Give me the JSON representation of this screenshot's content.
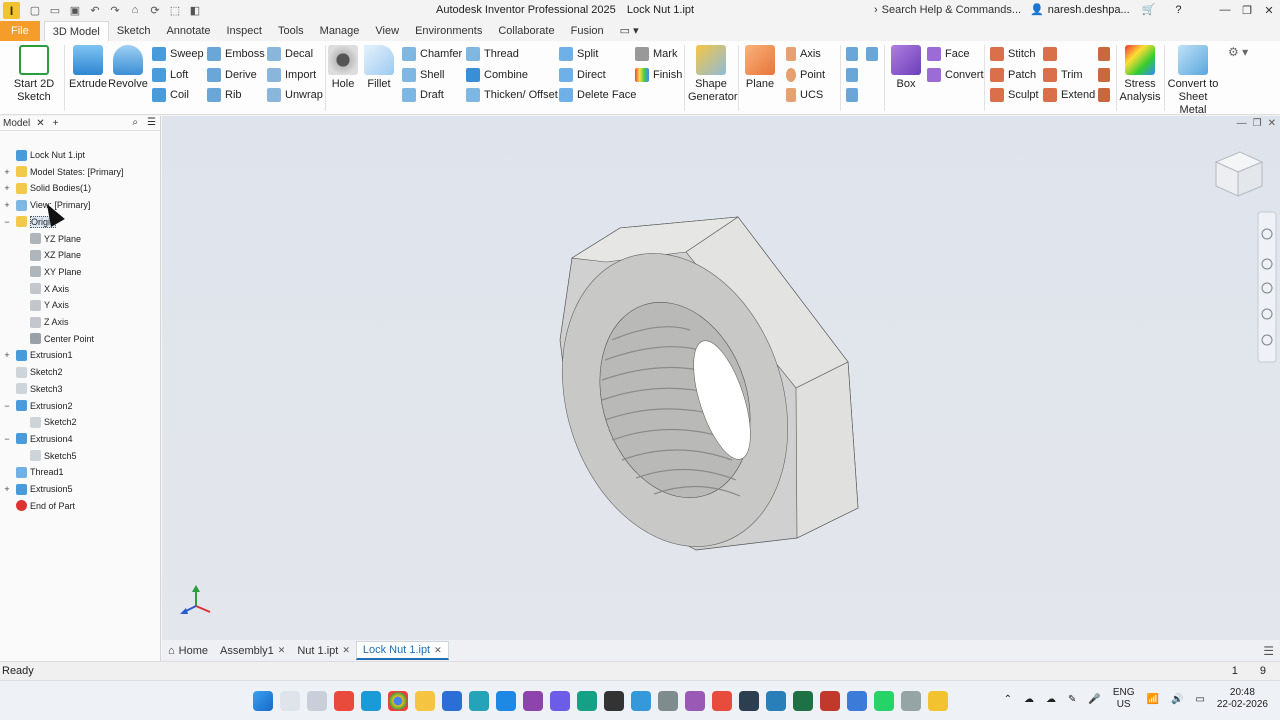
{
  "title_bar": {
    "app_name": "Autodesk Inventor Professional 2025",
    "document": "Lock Nut 1.ipt",
    "search_placeholder": "Search Help & Commands...",
    "user": "naresh.deshpa..."
  },
  "tabs": [
    "File",
    "3D Model",
    "Sketch",
    "Annotate",
    "Inspect",
    "Tools",
    "Manage",
    "View",
    "Environments",
    "Collaborate",
    "Fusion"
  ],
  "ribbon": {
    "start_sketch": "Start 2D Sketch",
    "extrude": "Extrude",
    "revolve": "Revolve",
    "sweep": "Sweep",
    "loft": "Loft",
    "coil": "Coil",
    "emboss": "Emboss",
    "derive": "Derive",
    "rib": "Rib",
    "decal": "Decal",
    "import": "Import",
    "unwrap": "Unwrap",
    "hole": "Hole",
    "fillet": "Fillet",
    "chamfer": "Chamfer",
    "shell": "Shell",
    "draft": "Draft",
    "thread": "Thread",
    "combine": "Combine",
    "thicken": "Thicken/ Offset",
    "split": "Split",
    "direct": "Direct",
    "delete_face": "Delete Face",
    "mark": "Mark",
    "finish": "Finish",
    "shape_generator": "Shape Generator",
    "plane": "Plane",
    "axis": "Axis",
    "point": "Point",
    "ucs": "UCS",
    "box": "Box",
    "face": "Face",
    "convert": "Convert",
    "stitch": "Stitch",
    "patch": "Patch",
    "sculpt": "Sculpt",
    "trim": "Trim",
    "extend": "Extend",
    "stress_analysis": "Stress Analysis",
    "convert_sheet_metal": "Convert to Sheet Metal"
  },
  "browser": {
    "tab_label": "Model",
    "tree": [
      {
        "label": "Lock Nut 1.ipt",
        "indent": 0,
        "expander": "",
        "icon": "part-icon"
      },
      {
        "label": "Model States: [Primary]",
        "indent": 0,
        "expander": "+",
        "icon": "folder-icon"
      },
      {
        "label": "Solid Bodies(1)",
        "indent": 0,
        "expander": "+",
        "icon": "folder-icon"
      },
      {
        "label": "View: [Primary]",
        "indent": 0,
        "expander": "+",
        "icon": "view-icon"
      },
      {
        "label": "Origin",
        "indent": 0,
        "expander": "−",
        "icon": "folder-icon",
        "selected": true
      },
      {
        "label": "YZ Plane",
        "indent": 1,
        "expander": "",
        "icon": "plane-icon"
      },
      {
        "label": "XZ Plane",
        "indent": 1,
        "expander": "",
        "icon": "plane-icon"
      },
      {
        "label": "XY Plane",
        "indent": 1,
        "expander": "",
        "icon": "plane-icon"
      },
      {
        "label": "X Axis",
        "indent": 1,
        "expander": "",
        "icon": "axis-icon"
      },
      {
        "label": "Y Axis",
        "indent": 1,
        "expander": "",
        "icon": "axis-icon"
      },
      {
        "label": "Z Axis",
        "indent": 1,
        "expander": "",
        "icon": "axis-icon"
      },
      {
        "label": "Center Point",
        "indent": 1,
        "expander": "",
        "icon": "point-icon"
      },
      {
        "label": "Extrusion1",
        "indent": 0,
        "expander": "+",
        "icon": "extrusion-icon"
      },
      {
        "label": "Sketch2",
        "indent": 0,
        "expander": "",
        "icon": "sketch-icon"
      },
      {
        "label": "Sketch3",
        "indent": 0,
        "expander": "",
        "icon": "sketch-icon"
      },
      {
        "label": "Extrusion2",
        "indent": 0,
        "expander": "−",
        "icon": "extrusion-icon"
      },
      {
        "label": "Sketch2",
        "indent": 1,
        "expander": "",
        "icon": "sketch-icon"
      },
      {
        "label": "Extrusion4",
        "indent": 0,
        "expander": "−",
        "icon": "extrusion-icon"
      },
      {
        "label": "Sketch5",
        "indent": 1,
        "expander": "",
        "icon": "sketch-icon"
      },
      {
        "label": "Thread1",
        "indent": 0,
        "expander": "",
        "icon": "thread-icon"
      },
      {
        "label": "Extrusion5",
        "indent": 0,
        "expander": "+",
        "icon": "extrusion-icon"
      },
      {
        "label": "End of Part",
        "indent": 0,
        "expander": "",
        "icon": "end-of-part-icon"
      }
    ]
  },
  "doc_tabs": [
    {
      "label": "Home",
      "closable": false,
      "active": false
    },
    {
      "label": "Assembly1",
      "closable": true,
      "active": false
    },
    {
      "label": "Nut 1.ipt",
      "closable": true,
      "active": false
    },
    {
      "label": "Lock Nut 1.ipt",
      "closable": true,
      "active": true
    }
  ],
  "status": {
    "text": "Ready",
    "num1": "1",
    "num2": "9"
  },
  "taskbar": {
    "lang": "ENG",
    "region": "US",
    "time": "20:48",
    "date": "22-02-2026"
  },
  "colors": {
    "accent": "#1f6fb2",
    "file_tab": "#f59d2a",
    "viewport_bg": "#e1e5ec"
  }
}
